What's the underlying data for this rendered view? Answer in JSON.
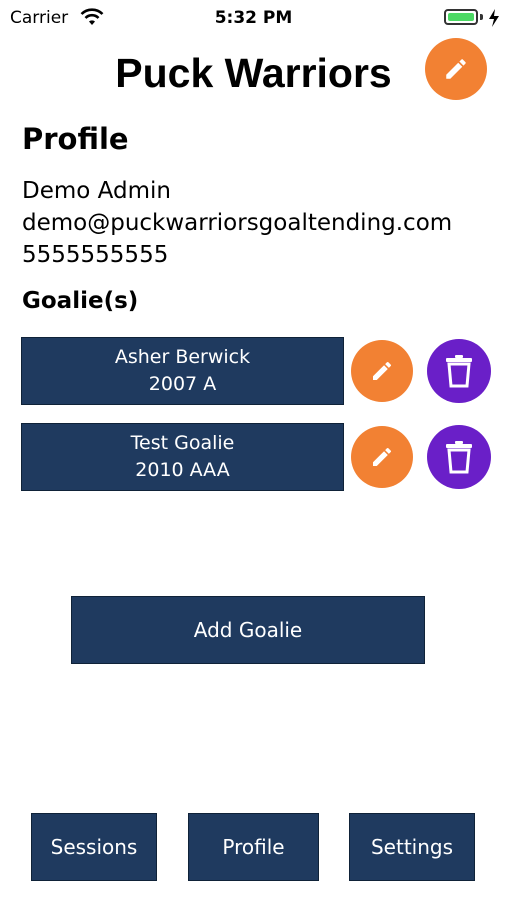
{
  "status_bar": {
    "carrier": "Carrier",
    "time": "5:32 PM",
    "battery_level": 1.0,
    "battery_color": "#4cd964"
  },
  "header": {
    "title": "Puck Warriors",
    "edit_icon": "pencil-icon"
  },
  "profile": {
    "heading": "Profile",
    "name": "Demo Admin",
    "email": "demo@puckwarriorsgoaltending.com",
    "phone": "5555555555"
  },
  "goalies": {
    "heading": "Goalie(s)",
    "items": [
      {
        "name": "Asher Berwick",
        "level": "2007 A"
      },
      {
        "name": "Test Goalie",
        "level": "2010 AAA"
      }
    ]
  },
  "add_goalie_label": "Add Goalie",
  "tabs": {
    "sessions": "Sessions",
    "profile": "Profile",
    "settings": "Settings"
  },
  "colors": {
    "navy": "#1f3a5f",
    "orange": "#f28133",
    "purple": "#6a1fc8"
  }
}
